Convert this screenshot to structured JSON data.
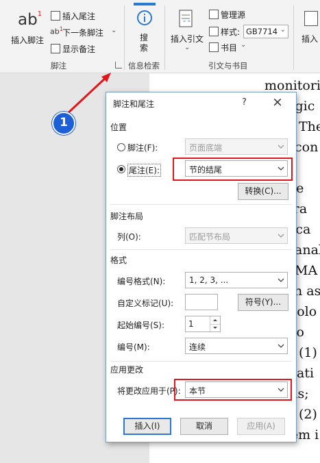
{
  "ribbon": {
    "footnote_group": {
      "insert_footnote_label": "插入脚注",
      "insert_footnote_icon_text": "ab",
      "insert_footnote_sup": "1",
      "insert_endnote_label": "插入尾注",
      "next_footnote_label": "下一条脚注",
      "show_notes_label": "显示备注",
      "group_label": "脚注"
    },
    "research_group": {
      "search_label": "搜索",
      "group_label": "信息检索"
    },
    "citations_group": {
      "insert_citation_label": "插入引文",
      "manage_sources_label": "管理源",
      "style_label": "样式:",
      "style_value": "GB7714",
      "bibliography_label": "书目",
      "group_label": "引文与书目"
    },
    "partial_button_label": "插入"
  },
  "callout": {
    "number": "1",
    "color": "#1d5fd6",
    "arrow_color": "#e0161b"
  },
  "document": {
    "lines": [
      "monitori",
      "logic",
      "The",
      "con",
      "em c",
      "slide",
      "epara",
      "nica",
      "anal",
      "MA",
      "n as",
      "nolo",
      "lts o",
      "(1)",
      "mati",
      "ysis;",
      "(2)",
      "system i"
    ]
  },
  "dialog": {
    "title": "脚注和尾注",
    "help": "?",
    "close": "×",
    "location_section": "位置",
    "footnote_label": "脚注(F):",
    "footnote_value": "页面底端",
    "endnote_label": "尾注(E):",
    "endnote_value": "节的结尾",
    "convert_button": "转换(C)...",
    "layout_section": "脚注布局",
    "columns_label": "列(O):",
    "columns_value": "匹配节布局",
    "format_section": "格式",
    "number_format_label": "编号格式(N):",
    "number_format_value": "1, 2, 3, ...",
    "custom_mark_label": "自定义标记(U):",
    "custom_mark_value": "",
    "symbol_button": "符号(Y)...",
    "start_at_label": "起始编号(S):",
    "start_at_value": "1",
    "numbering_label": "编号(M):",
    "numbering_value": "连续",
    "apply_section": "应用更改",
    "apply_to_label": "将更改应用于(P):",
    "apply_to_value": "本节",
    "insert_button": "插入(I)",
    "cancel_button": "取消",
    "apply_button": "应用(A)"
  },
  "colors": {
    "highlight_red": "#e0161b",
    "primary_blue": "#2b78d4"
  }
}
